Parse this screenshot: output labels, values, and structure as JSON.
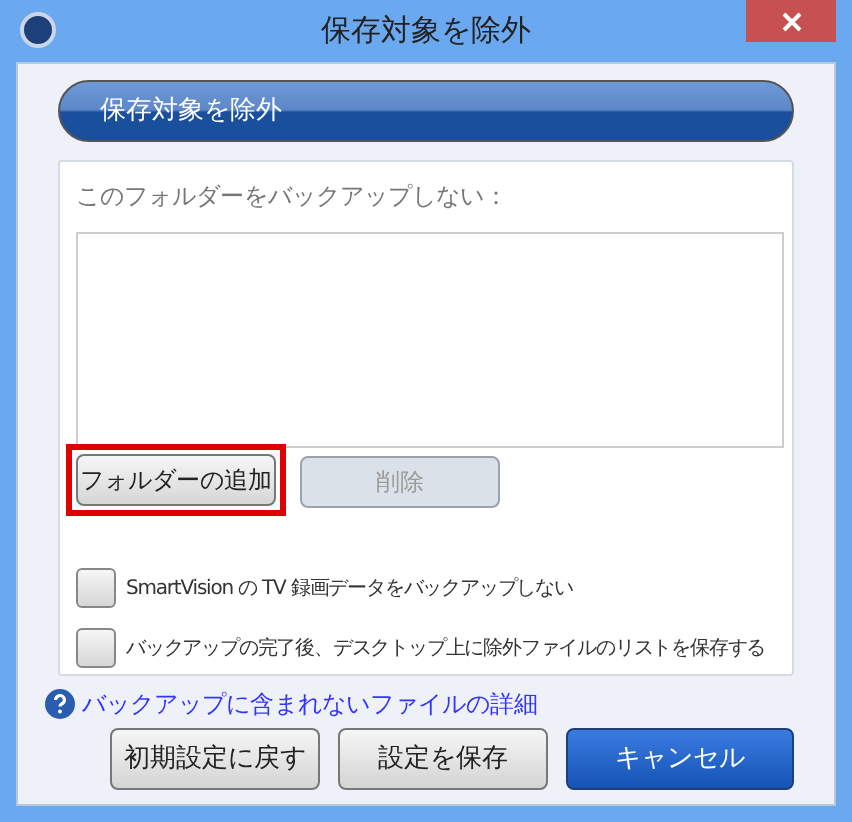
{
  "window": {
    "title": "保存対象を除外"
  },
  "header": {
    "title": "保存対象を除外"
  },
  "panel": {
    "label": "このフォルダーをバックアップしない：",
    "folder_buttons": [
      {
        "label": "フォルダーの追加",
        "disabled": false,
        "highlighted": true
      },
      {
        "label": "削除",
        "disabled": true,
        "highlighted": false
      }
    ],
    "options": [
      {
        "label": "SmartVision の TV 録画データをバックアップしない",
        "checked": false
      },
      {
        "label": "バックアップの完了後、デスクトップ上に除外ファイルのリストを保存する",
        "checked": false
      }
    ]
  },
  "help_link": "バックアップに含まれないファイルの詳細",
  "footer_buttons": [
    {
      "label": "初期設定に戻す",
      "kind": "normal"
    },
    {
      "label": "設定を保存",
      "kind": "normal"
    },
    {
      "label": "キャンセル",
      "kind": "primary"
    }
  ]
}
